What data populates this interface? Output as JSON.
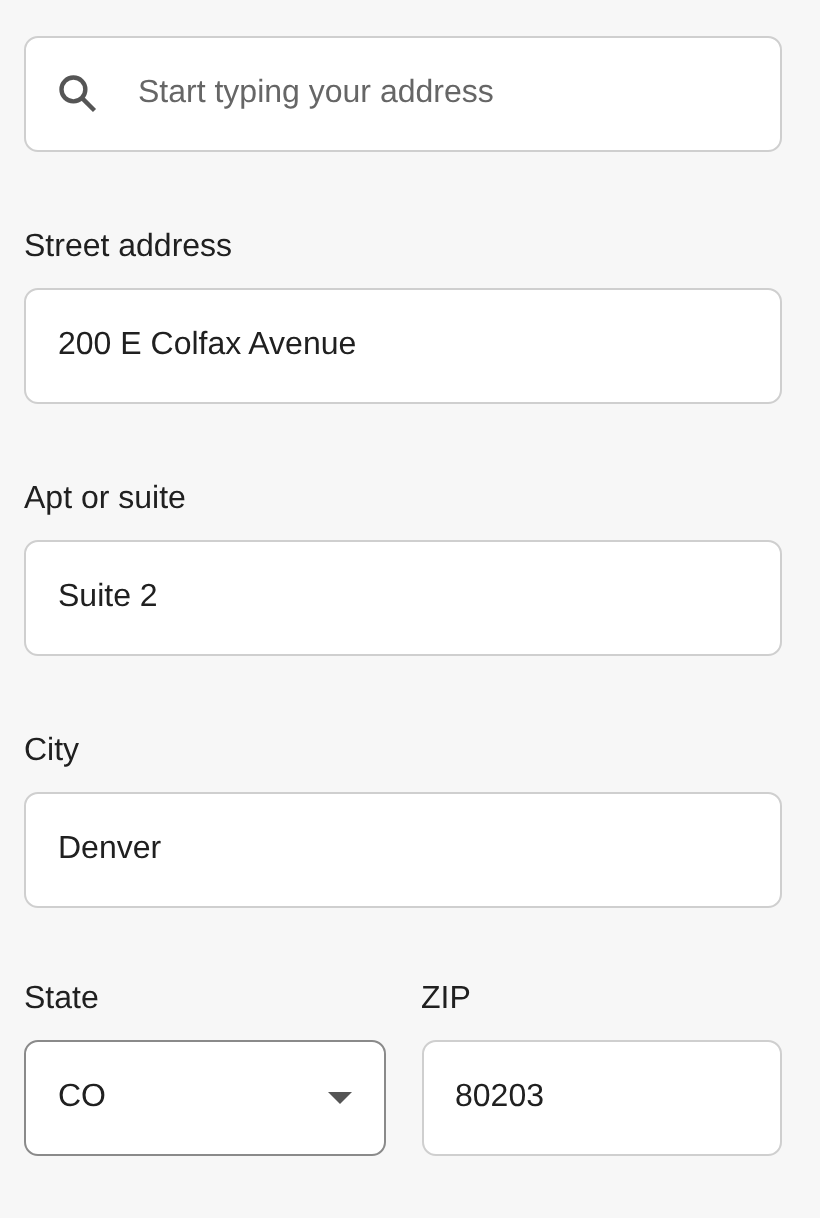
{
  "search": {
    "placeholder": "Start typing your address"
  },
  "fields": [
    {
      "label": "Street address",
      "value": "200 E Colfax Avenue",
      "kind": "text"
    },
    {
      "label": "Apt or suite",
      "value": "Suite 2",
      "kind": "text"
    },
    {
      "label": "City",
      "value": "Denver",
      "kind": "text"
    }
  ],
  "split_row": [
    {
      "label": "State",
      "value": "CO",
      "kind": "select"
    },
    {
      "label": "ZIP",
      "value": "80203",
      "kind": "text"
    }
  ]
}
